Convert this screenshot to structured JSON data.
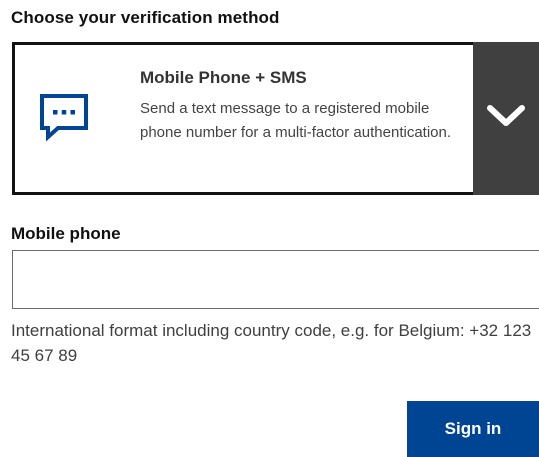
{
  "form": {
    "section_title": "Choose your verification method",
    "method": {
      "name": "Mobile Phone + SMS",
      "description": "Send a text message to a registered mobile phone number for a multi-factor authentication.",
      "icon": "sms-chat-icon",
      "toggle_icon": "chevron-down-icon"
    },
    "phone_label": "Mobile phone",
    "phone_value": "",
    "phone_placeholder": "",
    "help_text": "International format including country code, e.g. for Belgium: +32 123 45 67 89",
    "submit_label": "Sign in"
  },
  "colors": {
    "accent": "#004494",
    "toggle_bg": "#404040",
    "icon": "#004494"
  }
}
